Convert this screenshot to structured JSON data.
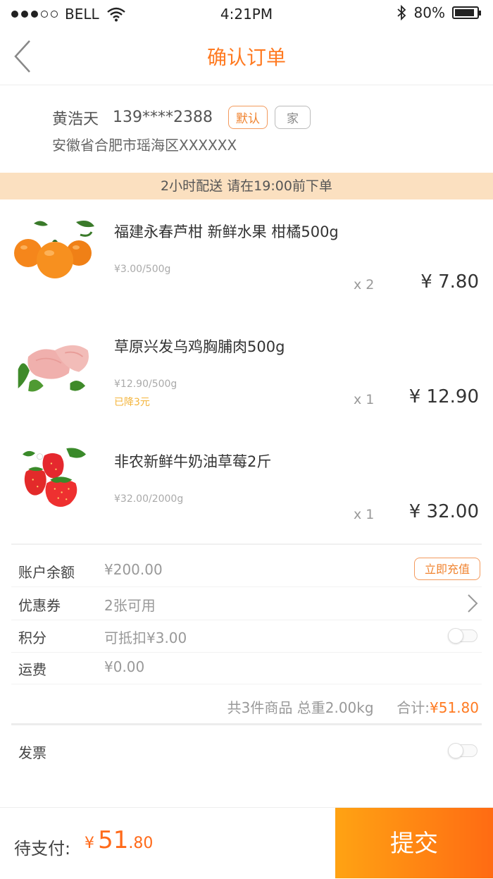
{
  "status_bar": {
    "carrier": "BELL",
    "time": "4:21PM",
    "battery": "80%"
  },
  "nav": {
    "title": "确认订单"
  },
  "address": {
    "name": "黄浩天",
    "phone": "139****2388",
    "tag_default": "默认",
    "tag_home": "家",
    "detail": "安徽省合肥市瑶海区XXXXXX"
  },
  "delivery_notice": "2小时配送 请在19:00前下单",
  "products": [
    {
      "title": "福建永春芦柑 新鲜水果 柑橘500g",
      "unit_price": "¥3.00/500g",
      "discount": "",
      "qty": "x 2",
      "price": "¥ 7.80",
      "image": "tangerine-image"
    },
    {
      "title": "草原兴发乌鸡胸脯肉500g",
      "unit_price": "¥12.90/500g",
      "discount": "已降3元",
      "qty": "x 1",
      "price": "¥ 12.90",
      "image": "chicken-breast-image"
    },
    {
      "title": "非农新鲜牛奶油草莓2斤",
      "unit_price": "¥32.00/2000g",
      "discount": "",
      "qty": "x 1",
      "price": "¥ 32.00",
      "image": "strawberry-image"
    }
  ],
  "options": {
    "balance": {
      "label": "账户余额",
      "value": "¥200.00",
      "button": "立即充值"
    },
    "coupon": {
      "label": "优惠券",
      "value": "2张可用"
    },
    "points": {
      "label": "积分",
      "value": "可抵扣¥3.00",
      "enabled": false
    },
    "shipping": {
      "label": "运费",
      "value": "¥0.00"
    }
  },
  "summary": {
    "text": "共3件商品 总重2.00kg",
    "total_label": "合计:",
    "total_value": "¥51.80"
  },
  "invoice": {
    "label": "发票",
    "enabled": false
  },
  "bottom": {
    "pay_label": "待支付:",
    "currency": "¥",
    "amount_int": "51",
    "amount_dec": ".80",
    "submit": "提交"
  },
  "colors": {
    "accent": "#ff7a21",
    "notice_bg": "#fbe0c0",
    "discount": "#f4b43a"
  }
}
